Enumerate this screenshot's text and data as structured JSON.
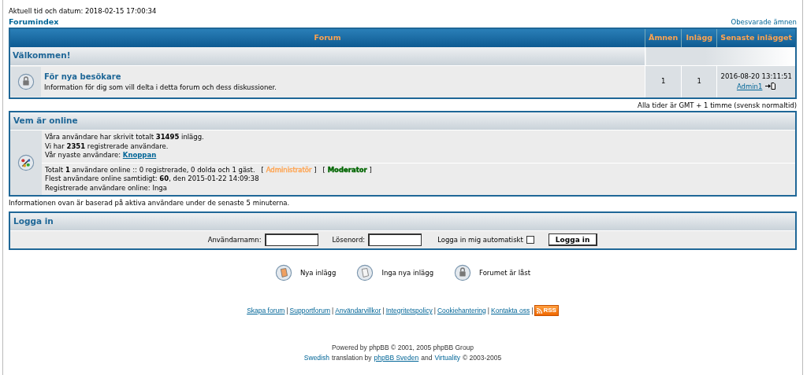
{
  "top": {
    "datetime": "Aktuell tid och datum: 2018-02-15 17:00:34",
    "index_link": "Forumindex",
    "unanswered_link": "Obesvarade ämnen"
  },
  "forum_table": {
    "columns": [
      "Forum",
      "Ämnen",
      "Inlägg",
      "Senaste inlägget"
    ],
    "categories": [
      {
        "title": "Välkommen!",
        "forums": [
          {
            "name": "För nya besökare",
            "description": "Information för dig som vill delta i detta forum och dess diskussioner.",
            "kind": "locked",
            "topics": "1",
            "posts": "1",
            "last_post_time": "2016-08-20 13:11:51",
            "last_post_author": "Admin1"
          }
        ]
      }
    ]
  },
  "timezone_note": "Alla tider är GMT + 1 timme (svensk normaltid)",
  "who_is_online": {
    "title": "Vem är online",
    "stats": [
      "Våra användare har skrivit totalt **31495** inlägg.",
      "Vi har **2351** registrerade användare."
    ],
    "newest_label": "Vår nyaste användare:",
    "newest_user": "Knoppan",
    "online_summary": "Totalt **1** användare online :: 0 registrerade, 0 dolda och 1 gäst.",
    "legend": [
      {
        "open": "[",
        "label": "Administratör",
        "close": "]",
        "color": "#ffa34f",
        "bold": false
      },
      {
        "open": "[",
        "label": "Moderator",
        "close": "]",
        "color": "#006600",
        "bold": true
      }
    ],
    "record": "Flest användare online samtidigt: **60**, den 2015-01-22 14:09:38",
    "registered_online": "Registrerade användare online: Inga"
  },
  "online_note": "Informationen ovan är baserad på aktiva användare under de senaste 5 minuterna.",
  "login": {
    "title": "Logga in",
    "username_label": "Användarnamn:",
    "password_label": "Lösenord:",
    "auto_label": "Logga in mig automatiskt",
    "auto_checked": false,
    "button": "Logga in"
  },
  "legend_icons": [
    {
      "kind": "new",
      "label": "Nya inlägg"
    },
    {
      "kind": "nonew",
      "label": "Inga nya inlägg"
    },
    {
      "kind": "locked",
      "label": "Forumet är låst"
    }
  ],
  "footer_links": [
    {
      "label": "Skapa forum",
      "separator": "|"
    },
    {
      "label": "Supportforum",
      "separator": "|"
    },
    {
      "label": "Användarvillkor",
      "separator": "|"
    },
    {
      "label": "Integritetspolicy",
      "separator": "|"
    },
    {
      "label": "Cookiehantering",
      "separator": "|"
    },
    {
      "label": "Kontakta oss",
      "separator": "|"
    }
  ],
  "rss_badge": "RSS",
  "powered_by": "Powered by phpBB © 2001, 2005 phpBB Group",
  "translation": {
    "lang_link": "Swedish",
    "text1": "translation by",
    "link1": "phpBB Sveden",
    "text2": "and",
    "link2": "Virtuality",
    "text3": "© 2003-2005"
  }
}
